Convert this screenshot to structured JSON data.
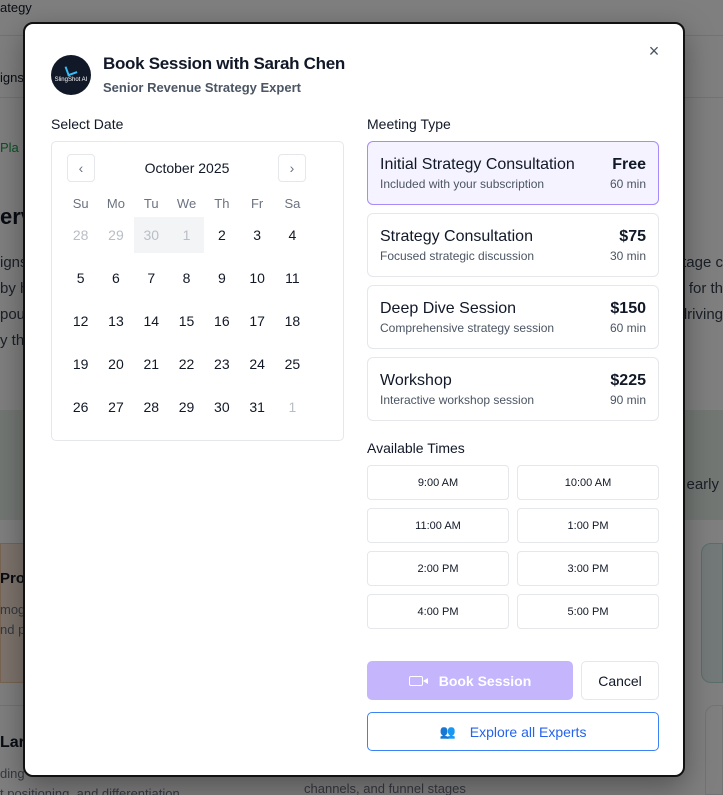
{
  "background": {
    "top_text": "ategy",
    "tab_text": "igns",
    "green_text": "Pla",
    "section_title": "erv",
    "left_lines": [
      "igns",
      "by h",
      "pou",
      "y th"
    ],
    "right_lines": [
      "tage c",
      "for th",
      "driving"
    ],
    "band_text": "early",
    "card_left_title": "Prof",
    "card_left_lines": [
      "mog",
      "nd p"
    ],
    "bottom_left_title": "Lar",
    "bottom_left_lines": [
      "ding",
      "t positioning, and differentiation"
    ],
    "bottom_mid_text": "channels, and funnel stages"
  },
  "modal": {
    "close_glyph": "×",
    "logo_text": "SlingShot AI",
    "expert_name": "Book Session with Sarah Chen",
    "expert_title": "Senior Revenue Strategy Expert",
    "select_date_label": "Select Date",
    "meeting_type_label": "Meeting Type",
    "available_times_label": "Available Times"
  },
  "calendar": {
    "month": "October 2025",
    "prev_icon": "‹",
    "next_icon": "›",
    "weekdays": [
      "Su",
      "Mo",
      "Tu",
      "We",
      "Th",
      "Fr",
      "Sa"
    ],
    "weeks": [
      [
        "28",
        "29",
        "30",
        "1",
        "2",
        "3",
        "4"
      ],
      [
        "5",
        "6",
        "7",
        "8",
        "9",
        "10",
        "11"
      ],
      [
        "12",
        "13",
        "14",
        "15",
        "16",
        "17",
        "18"
      ],
      [
        "19",
        "20",
        "21",
        "22",
        "23",
        "24",
        "25"
      ],
      [
        "26",
        "27",
        "28",
        "29",
        "30",
        "31",
        "1"
      ]
    ]
  },
  "meeting_types": [
    {
      "name": "Initial Strategy Consultation",
      "price": "Free",
      "description": "Included with your subscription",
      "duration": "60 min",
      "selected": true
    },
    {
      "name": "Strategy Consultation",
      "price": "$75",
      "description": "Focused strategic discussion",
      "duration": "30 min",
      "selected": false
    },
    {
      "name": "Deep Dive Session",
      "price": "$150",
      "description": "Comprehensive strategy session",
      "duration": "60 min",
      "selected": false
    },
    {
      "name": "Workshop",
      "price": "$225",
      "description": "Interactive workshop session",
      "duration": "90 min",
      "selected": false
    }
  ],
  "times": [
    "9:00 AM",
    "10:00 AM",
    "11:00 AM",
    "1:00 PM",
    "2:00 PM",
    "3:00 PM",
    "4:00 PM",
    "5:00 PM"
  ],
  "actions": {
    "book_label": "Book Session",
    "cancel_label": "Cancel",
    "explore_label": "Explore all Experts"
  },
  "colors": {
    "selected_border": "#a78bfa",
    "book_button": "#c4b5fd",
    "explore_border": "#3b82f6"
  }
}
